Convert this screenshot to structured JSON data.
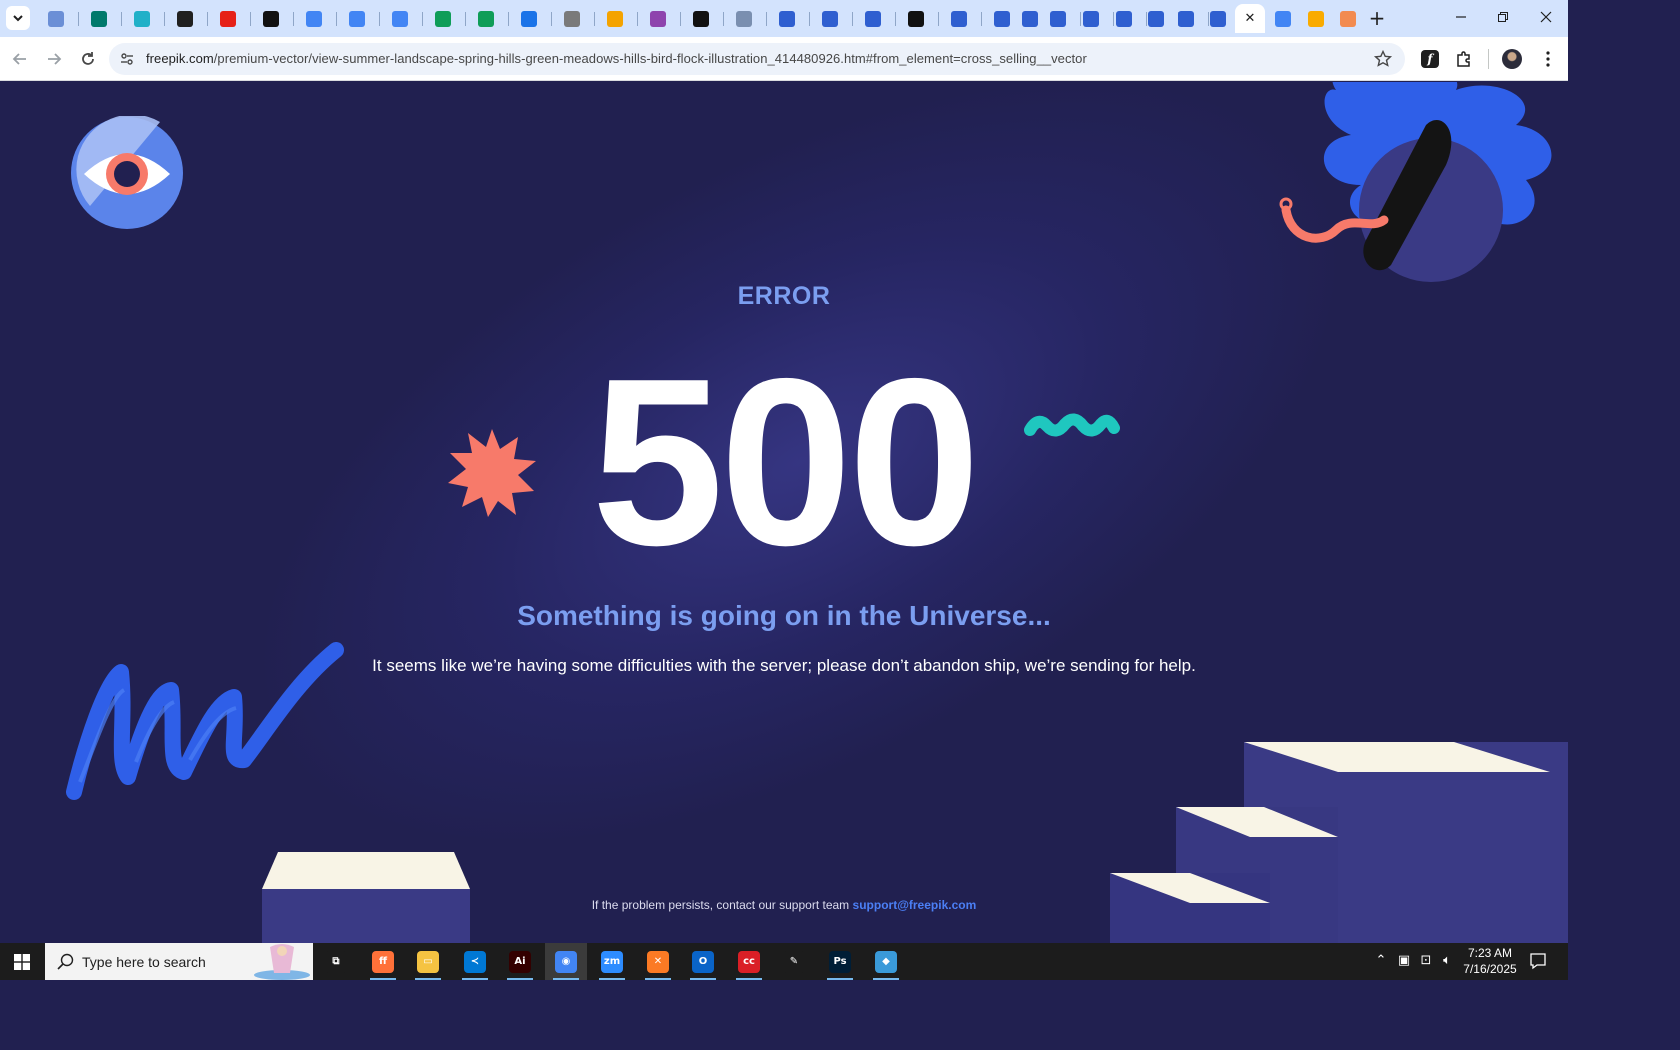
{
  "browser": {
    "url_host": "freepik.com",
    "url_path": "/premium-vector/view-summer-landscape-spring-hills-green-meadows-hills-bird-flock-illustration_414480926.htm#from_element=cross_selling__vector",
    "tabs": [
      {
        "icon": "globe-blue-icon",
        "color": "#6b8fd6"
      },
      {
        "icon": "vpn-icon",
        "color": "#00796b"
      },
      {
        "icon": "diamond-icon",
        "color": "#20b0c8"
      },
      {
        "icon": "openai-icon",
        "color": "#202020"
      },
      {
        "icon": "youtube-icon",
        "color": "#e62117"
      },
      {
        "icon": "bolt-icon",
        "color": "#111111"
      },
      {
        "icon": "docs-icon",
        "color": "#4285f4"
      },
      {
        "icon": "docs-icon",
        "color": "#4285f4"
      },
      {
        "icon": "docs-icon",
        "color": "#4285f4"
      },
      {
        "icon": "sheets-icon",
        "color": "#0f9d58"
      },
      {
        "icon": "sheets-icon",
        "color": "#0f9d58"
      },
      {
        "icon": "translate-icon",
        "color": "#1a73e8"
      },
      {
        "icon": "globe-gray-icon",
        "color": "#7a7a7a"
      },
      {
        "icon": "vee-icon",
        "color": "#f4a300"
      },
      {
        "icon": "braces-icon",
        "color": "#8e44ad"
      },
      {
        "icon": "lambda-icon",
        "color": "#111111"
      },
      {
        "icon": "repo-icon",
        "color": "#7a8fb0"
      },
      {
        "icon": "forms-icon",
        "color": "#2f5fd0"
      },
      {
        "icon": "forms-icon",
        "color": "#2f5fd0"
      },
      {
        "icon": "forms-icon",
        "color": "#2f5fd0"
      },
      {
        "icon": "medium-icon",
        "color": "#111111"
      },
      {
        "icon": "forms-icon",
        "color": "#2f5fd0"
      },
      {
        "icon": "forms-icon",
        "color": "#2f5fd0"
      },
      {
        "icon": "forms-icon",
        "color": "#2f5fd0"
      },
      {
        "icon": "forms-icon",
        "color": "#2f5fd0"
      },
      {
        "icon": "forms-icon",
        "color": "#2f5fd0"
      },
      {
        "icon": "forms-icon",
        "color": "#2f5fd0"
      },
      {
        "icon": "forms-icon",
        "color": "#2f5fd0"
      },
      {
        "icon": "forms-icon",
        "color": "#2f5fd0"
      },
      {
        "icon": "forms-icon",
        "color": "#2f5fd0"
      }
    ],
    "active_tab_close": "✕",
    "after_tabs": [
      {
        "icon": "google-icon",
        "color": "#4285f4"
      },
      {
        "icon": "classroom-icon",
        "color": "#f9ab00"
      },
      {
        "icon": "hand-icon",
        "color": "#f28b50"
      }
    ],
    "new_tab_label": "+"
  },
  "page": {
    "error_label": "ERROR",
    "code": "500",
    "headline": "Something is going on in the Universe...",
    "subline": "It seems like we’re having some difficulties with the server; please don’t abandon ship, we’re sending for help.",
    "footer_text": "If the problem persists, contact our support team",
    "support_email": "support@freepik.com",
    "colors": {
      "background": "#212050",
      "accent_blue": "#7b9ef0",
      "coral": "#f77a6a",
      "teal": "#1fc7bf",
      "brush_blue": "#2f5fe8",
      "step_face": "#3a3a85",
      "step_top": "#f8f4e6"
    }
  },
  "taskbar": {
    "search_placeholder": "Type here to search",
    "apps": [
      {
        "name": "task-view",
        "color": "#1c1c1c",
        "glyph": "⧉"
      },
      {
        "name": "firefox",
        "color": "#ff7139",
        "glyph": "ff"
      },
      {
        "name": "file-explorer",
        "color": "#f5c342",
        "glyph": "▭"
      },
      {
        "name": "vscode",
        "color": "#0078d4",
        "glyph": "≺"
      },
      {
        "name": "illustrator",
        "color": "#330000",
        "glyph": "Ai"
      },
      {
        "name": "chrome",
        "color": "#4285f4",
        "glyph": "◉"
      },
      {
        "name": "zoom",
        "color": "#2d8cff",
        "glyph": "zm"
      },
      {
        "name": "xampp",
        "color": "#fb7a24",
        "glyph": "✕"
      },
      {
        "name": "outlook",
        "color": "#0a64c8",
        "glyph": "O"
      },
      {
        "name": "creative-cloud",
        "color": "#da1f26",
        "glyph": "cc"
      },
      {
        "name": "pen-tool",
        "color": "#1c1c1c",
        "glyph": "✎"
      },
      {
        "name": "photoshop",
        "color": "#001e36",
        "glyph": "Ps"
      },
      {
        "name": "app-diamond",
        "color": "#3a9ad9",
        "glyph": "◆"
      }
    ],
    "time": "7:23 AM",
    "date": "7/16/2025"
  }
}
